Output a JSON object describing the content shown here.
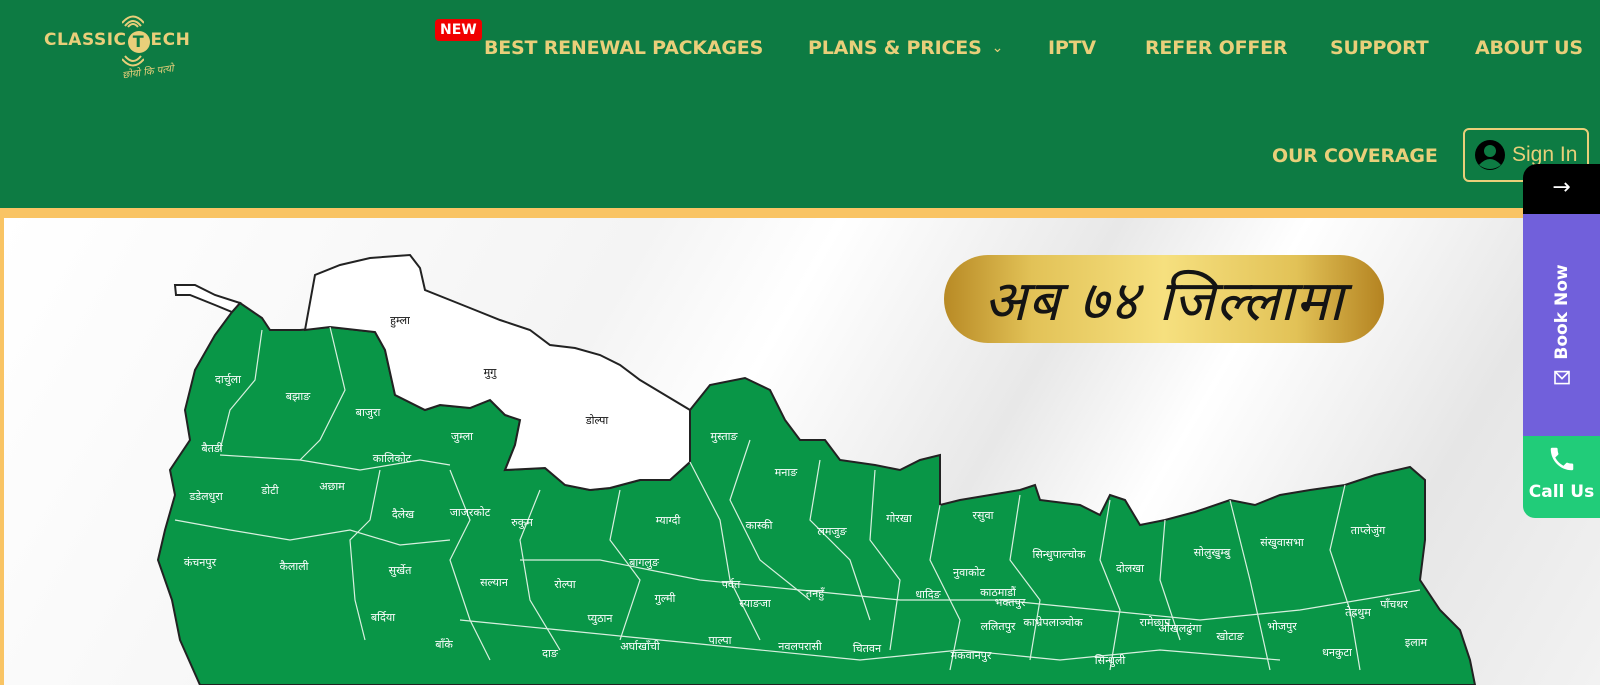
{
  "brand": {
    "name_part1": "CLASSIC",
    "name_t": "T",
    "name_part2": "ECH",
    "tagline": "छोयो कि पत्यो",
    "colors": {
      "header_bg": "#0d7b43",
      "nav_text": "#e9cf7a",
      "gold_bar": "#f9c464",
      "badge_new": "#f00000",
      "map_green": "#099647",
      "book_now": "#7160db",
      "call_us": "#21cc79"
    }
  },
  "nav": {
    "badge": "NEW",
    "items": [
      {
        "label": "BEST RENEWAL PACKAGES"
      },
      {
        "label": "PLANS & PRICES",
        "has_dropdown": true
      },
      {
        "label": "IPTV"
      },
      {
        "label": "REFER OFFER"
      },
      {
        "label": "SUPPORT"
      },
      {
        "label": "ABOUT US"
      },
      {
        "label": "OUR COVERAGE"
      }
    ],
    "dropdown_icon": "chevron-down-icon",
    "signin_label": "Sign In",
    "signin_icon": "user-avatar-icon"
  },
  "hero": {
    "banner_text": "अब ७४ जिल्लामा"
  },
  "map": {
    "uncovered": [
      "हुम्ला",
      "मुगु",
      "डोल्पा"
    ],
    "districts": [
      "दार्चुला",
      "बझाङ",
      "बाजुरा",
      "बैतडी",
      "डडेलधुरा",
      "डोटी",
      "अछाम",
      "कालिकोट",
      "जुम्ला",
      "कंचनपुर",
      "कैलाली",
      "सुर्खेत",
      "दैलेख",
      "जाजरकोट",
      "रुकुम",
      "बर्दिया",
      "बाँके",
      "सल्यान",
      "रोल्पा",
      "दाङ",
      "प्युठान",
      "म्याग्दी",
      "बागलुङ",
      "पर्वत",
      "गुल्मी",
      "अर्घाखाँची",
      "पाल्पा",
      "स्याङजा",
      "मुस्ताङ",
      "मनाङ",
      "कास्की",
      "लमजुङ",
      "तनहुँ",
      "नवलपरासी",
      "चितवन",
      "गोरखा",
      "रसुवा",
      "नुवाकोट",
      "धादिङ",
      "काठमाडौं",
      "भक्तपुर",
      "ललितपुर",
      "सिन्धुपाल्चोक",
      "काभ्रेपलाञ्चोक",
      "मकवानपुर",
      "दोलखा",
      "रामेछाप",
      "सिन्धुली",
      "सोलुखुम्बु",
      "ओखलढुंगा",
      "खोटाङ",
      "संखुवासभा",
      "भोजपुर",
      "ताप्लेजुंग",
      "तेह्रथुम",
      "पाँचथर",
      "धनकुटा",
      "इलाम"
    ]
  },
  "side_widget": {
    "arrow": "→",
    "book_now_label": "Book Now",
    "book_now_icon": "envelope-icon",
    "call_label": "Call Us",
    "call_icon": "phone-icon"
  }
}
